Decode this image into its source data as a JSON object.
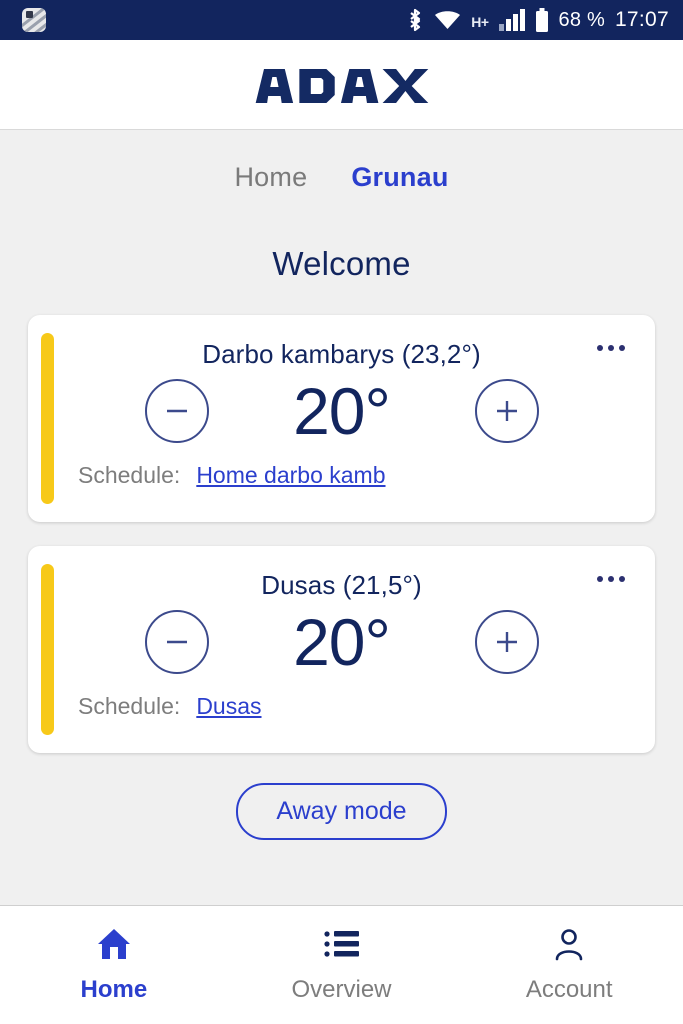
{
  "statusbar": {
    "app_icon": "app-badge-icon",
    "bluetooth_icon": "bluetooth-icon",
    "wifi_icon": "wifi-icon",
    "network_type": "H+",
    "signal_icon": "signal-bars-icon",
    "battery_icon": "battery-icon",
    "battery_percent": "68 %",
    "time": "17:07"
  },
  "header": {
    "logo_text": "ADAX"
  },
  "tabs": [
    {
      "label": "Home",
      "active": false
    },
    {
      "label": "Grunau",
      "active": true
    }
  ],
  "page_title": "Welcome",
  "rooms": [
    {
      "title": "Darbo kambarys (23,2°)",
      "temperature": "20°",
      "schedule_label": "Schedule:",
      "schedule_value": "Home darbo kamb",
      "decrease_icon": "minus-circle-icon",
      "increase_icon": "plus-circle-icon",
      "menu_icon": "more-options-icon",
      "accent_color": "#f7c919"
    },
    {
      "title": "Dusas (21,5°)",
      "temperature": "20°",
      "schedule_label": "Schedule:",
      "schedule_value": "Dusas",
      "decrease_icon": "minus-circle-icon",
      "increase_icon": "plus-circle-icon",
      "menu_icon": "more-options-icon",
      "accent_color": "#f7c919"
    }
  ],
  "away_button": "Away mode",
  "bottom_nav": [
    {
      "label": "Home",
      "icon": "home-icon",
      "active": true
    },
    {
      "label": "Overview",
      "icon": "list-icon",
      "active": false
    },
    {
      "label": "Account",
      "icon": "person-icon",
      "active": false
    }
  ],
  "colors": {
    "brand_navy": "#12255e",
    "accent_blue": "#2b3fcd",
    "accent_yellow": "#f7c919",
    "muted_gray": "#7d7d7d",
    "page_bg": "#f0f0f0"
  }
}
